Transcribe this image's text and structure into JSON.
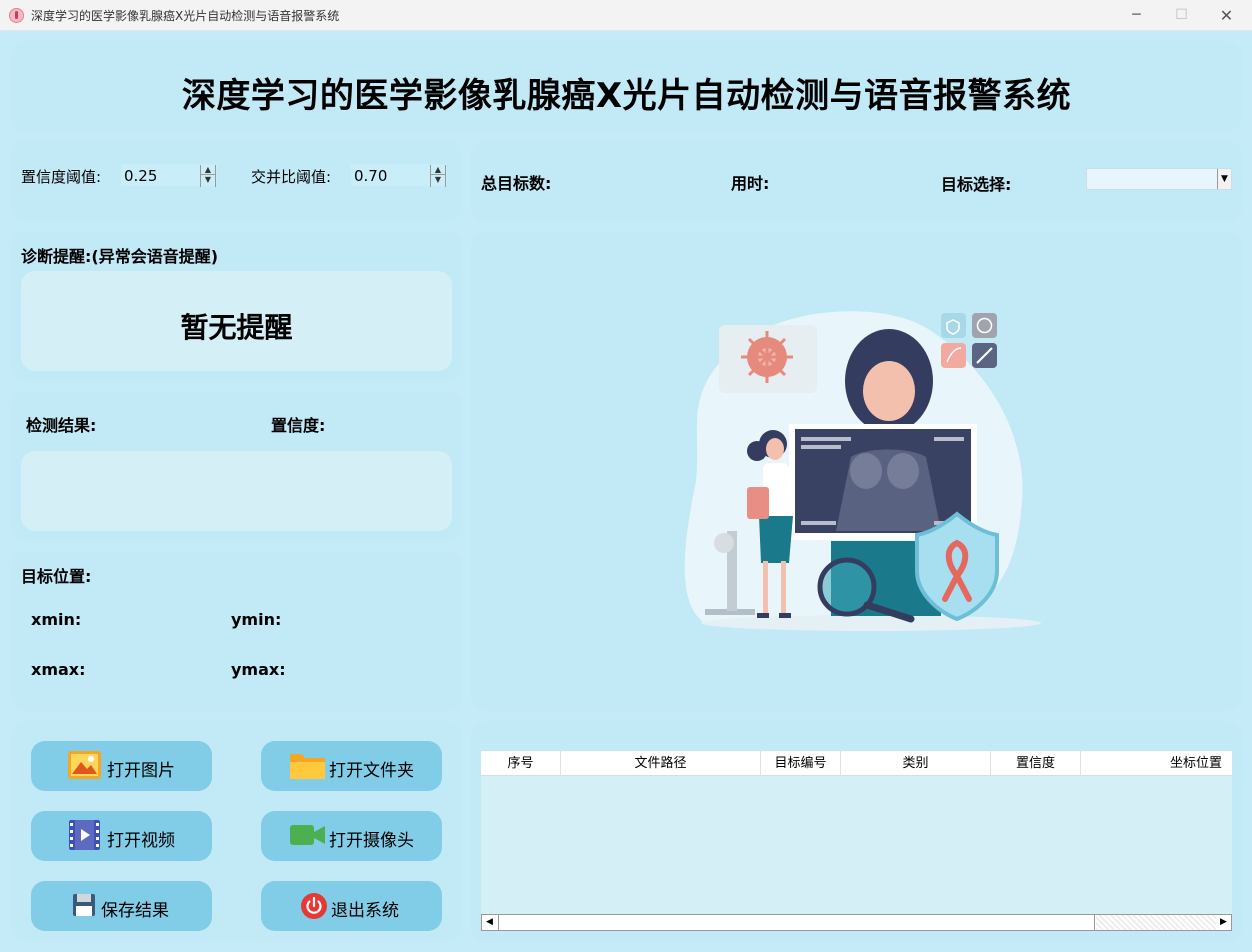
{
  "window": {
    "title": "深度学习的医学影像乳腺癌X光片自动检测与语音报警系统",
    "min": "─",
    "max": "☐",
    "close": "✕"
  },
  "header": {
    "title": "深度学习的医学影像乳腺癌X光片自动检测与语音报警系统"
  },
  "thresholds": {
    "confidence_label": "置信度阈值:",
    "confidence_value": "0.25",
    "iou_label": "交并比阈值:",
    "iou_value": "0.70"
  },
  "stats": {
    "total_label": "总目标数:",
    "time_label": "用时:",
    "select_label": "目标选择:",
    "select_value": ""
  },
  "alert": {
    "label": "诊断提醒:(异常会语音提醒)",
    "text": "暂无提醒"
  },
  "result": {
    "label": "检测结果:",
    "confidence_label": "置信度:"
  },
  "position": {
    "label": "目标位置:",
    "xmin": "xmin:",
    "ymin": "ymin:",
    "xmax": "xmax:",
    "ymax": "ymax:"
  },
  "buttons": {
    "open_image": "打开图片",
    "open_folder": "打开文件夹",
    "open_video": "打开视频",
    "open_camera": "打开摄像头",
    "save": "保存结果",
    "exit": "退出系统"
  },
  "table": {
    "columns": [
      "序号",
      "文件路径",
      "目标编号",
      "类别",
      "置信度",
      "坐标位置"
    ],
    "rows": []
  },
  "colors": {
    "background": "#c6ebf8",
    "panel": "#c2e9f6",
    "button": "#81cce6",
    "display_box": "#d5eff6"
  },
  "icons": {
    "image": "picture-icon",
    "folder": "folder-icon",
    "video": "film-icon",
    "camera": "video-camera-icon",
    "save": "floppy-disk-icon",
    "exit": "power-icon"
  }
}
